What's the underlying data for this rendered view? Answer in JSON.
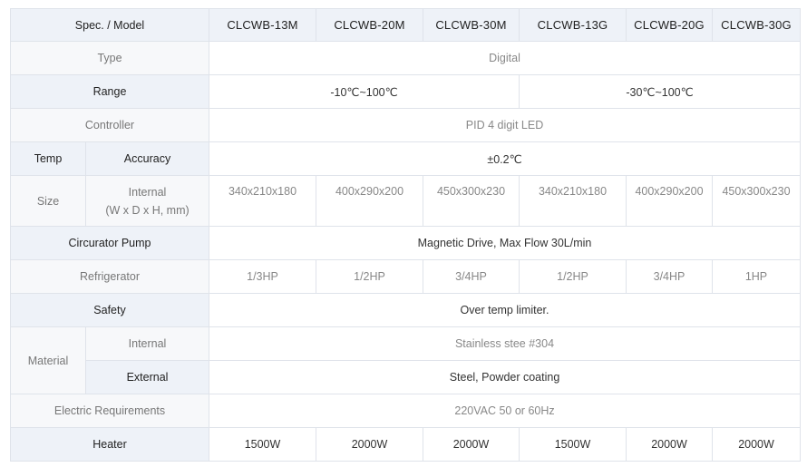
{
  "header": {
    "spec_label": "Spec. / Model",
    "models": [
      "CLCWB-13M",
      "CLCWB-20M",
      "CLCWB-30M",
      "CLCWB-13G",
      "CLCWB-20G",
      "CLCWB-30G"
    ]
  },
  "rows": {
    "type": {
      "label": "Type",
      "value": "Digital"
    },
    "range": {
      "label": "Range",
      "value_m": "-10℃~100℃",
      "value_g": "-30℃~100℃"
    },
    "controller": {
      "label": "Controller",
      "value": "PID 4 digit LED"
    },
    "temp": {
      "label": "Temp",
      "sub_label": "Accuracy",
      "value": "±0.2℃"
    },
    "size": {
      "label": "Size",
      "sub_label_1": "Internal",
      "sub_label_2": "(W x D x H, mm)",
      "values": [
        "340x210x180",
        "400x290x200",
        "450x300x230",
        "340x210x180",
        "400x290x200",
        "450x300x230"
      ]
    },
    "pump": {
      "label": "Circurator Pump",
      "value": "Magnetic Drive, Max Flow 30L/min"
    },
    "refrigerator": {
      "label": "Refrigerator",
      "values": [
        "1/3HP",
        "1/2HP",
        "3/4HP",
        "1/2HP",
        "3/4HP",
        "1HP"
      ]
    },
    "safety": {
      "label": "Safety",
      "value": "Over temp limiter."
    },
    "material": {
      "label": "Material",
      "internal_label": "Internal",
      "internal_value": "Stainless stee #304",
      "external_label": "External",
      "external_value": "Steel, Powder coating"
    },
    "electric": {
      "label": "Electric Requirements",
      "value": "220VAC 50 or 60Hz"
    },
    "heater": {
      "label": "Heater",
      "values": [
        "1500W",
        "2000W",
        "2000W",
        "1500W",
        "2000W",
        "2000W"
      ]
    }
  }
}
